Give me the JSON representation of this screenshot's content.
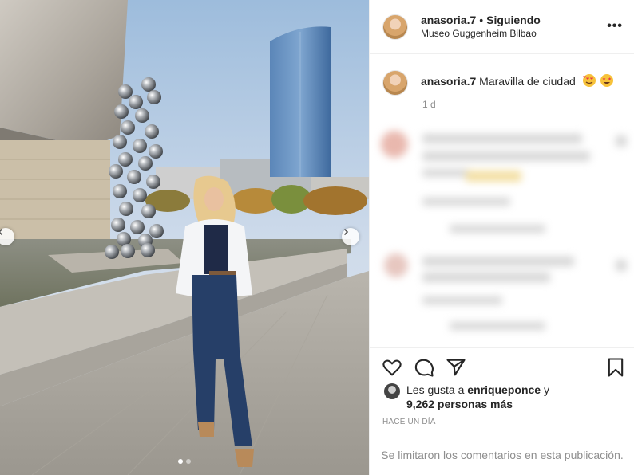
{
  "post": {
    "username": "anasoria.7",
    "separator": "•",
    "follow_status": "Siguiendo",
    "location": "Museo Guggenheim Bilbao",
    "more_glyph": "•••"
  },
  "caption": {
    "username": "anasoria.7",
    "text": "Maravilla de ciudad",
    "emojis": [
      "smiling-face-with-hearts",
      "star-struck"
    ],
    "time": "1 d"
  },
  "likes": {
    "prefix": "Les gusta a",
    "liker": "enriqueponce",
    "conjunction": "y",
    "others": "9,262 personas más"
  },
  "posted_ago": "HACE UN DÍA",
  "comments_disabled": "Se limitaron los comentarios en esta publicación.",
  "carousel": {
    "slide_count": 2,
    "active_slide": 1
  },
  "icons": {
    "like": "heart-icon",
    "comment": "comment-icon",
    "share": "paper-plane-icon",
    "save": "bookmark-icon",
    "more": "more-options-icon",
    "prev": "chevron-left-icon",
    "next": "chevron-right-icon"
  },
  "colors": {
    "text": "#262626",
    "secondary": "#8e8e8e",
    "divider": "#efefef"
  }
}
